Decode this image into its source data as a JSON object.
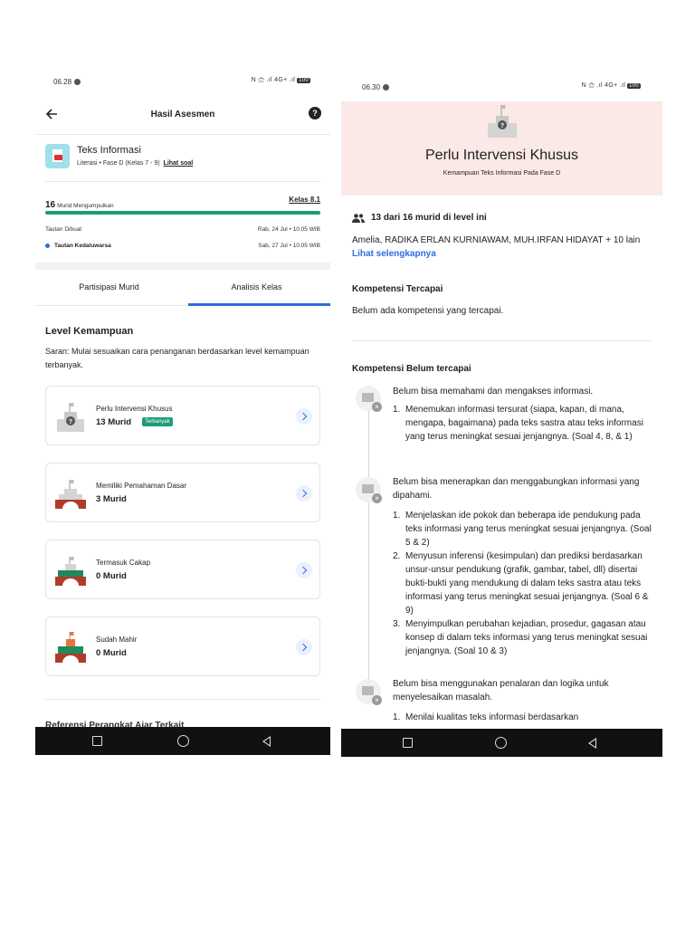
{
  "left": {
    "status": {
      "time": "06.28",
      "icons": "N ⚝ .ıl 4G+ .ıl",
      "battery": "100"
    },
    "appbar": {
      "title": "Hasil Asesmen",
      "back_icon": "back-arrow-icon",
      "help_icon": "help-icon"
    },
    "subject": {
      "title": "Teks Informasi",
      "meta": "Literasi • Fase D (Kelas 7 - 9)",
      "link": "Lihat soal"
    },
    "summary": {
      "count": "16",
      "count_label": "Murid Mengumpulkan",
      "kelas": "Kelas 8.1",
      "progress_fraction": 1.0,
      "created_label": "Tautan Dibuat",
      "created_value": "Rab, 24 Jul • 10:05 WIB",
      "expiry_label": "Tautan Kedaluwarsa",
      "expiry_value": "Sab, 27 Jul • 10:05 WIB"
    },
    "tabs": [
      {
        "label": "Partisipasi Murid",
        "active": false
      },
      {
        "label": "Analisis Kelas",
        "active": true
      }
    ],
    "level_section": {
      "title": "Level Kemampuan",
      "desc": "Saran: Mulai sesuaikan cara penanganan berdasarkan level kemampuan terbanyak."
    },
    "levels": [
      {
        "name": "Perlu Intervensi Khusus",
        "count": "13 Murid",
        "badge": "Terbanyak"
      },
      {
        "name": "Memiliki Pemahaman Dasar",
        "count": "3 Murid",
        "badge": ""
      },
      {
        "name": "Termasuk Cakap",
        "count": "0 Murid",
        "badge": ""
      },
      {
        "name": "Sudah Mahir",
        "count": "0 Murid",
        "badge": ""
      }
    ],
    "cut_heading": "Referensi Perangkat Ajar Terkait"
  },
  "right": {
    "status": {
      "time": "06.30",
      "icons": "N ⚝ .ıl 4G+ .ıl",
      "battery": "100"
    },
    "hero": {
      "title": "Perlu Intervensi Khusus",
      "subtitle": "Kemampuan Teks Informasi Pada Fase D"
    },
    "students": {
      "count": "13 dari 16 murid di level ini",
      "names": "Amelia, RADIKA ERLAN KURNIAWAM, MUH.IRFAN HIDAYAT + 10 lain",
      "more": "Lihat selengkapnya"
    },
    "achieved": {
      "title": "Kompetensi Tercapai",
      "text": "Belum ada kompetensi yang tercapai."
    },
    "not_achieved": {
      "title": "Kompetensi Belum tercapai",
      "items": [
        {
          "title": "Belum bisa memahami dan mengakses informasi.",
          "points": [
            "Menemukan informasi tersurat (siapa, kapan, di mana, mengapa, bagaimana) pada teks sastra atau teks informasi yang terus meningkat sesuai jenjangnya. (Soal 4, 8, & 1)"
          ]
        },
        {
          "title": "Belum bisa menerapkan dan menggabungkan informasi yang dipahami.",
          "points": [
            "Menjelaskan ide pokok dan beberapa ide pendukung pada teks informasi yang terus meningkat sesuai jenjangnya. (Soal 5 & 2)",
            "Menyusun inferensi (kesimpulan) dan prediksi berdasarkan unsur-unsur pendukung (grafik, gambar, tabel, dll) disertai bukti-bukti yang mendukung di dalam teks sastra atau teks informasi yang terus meningkat sesuai jenjangnya. (Soal 6 & 9)",
            "Menyimpulkan perubahan kejadian, prosedur, gagasan atau konsep di dalam teks informasi yang terus meningkat sesuai jenjangnya. (Soal 10 & 3)"
          ]
        },
        {
          "title": "Belum bisa menggunakan penalaran dan logika untuk menyelesaikan masalah.",
          "points": [
            "Menilai kualitas teks informasi berdasarkan"
          ]
        }
      ]
    }
  },
  "colors": {
    "accent": "#2d6cdf",
    "success": "#1a9d77",
    "hero_bg": "#fbe9e7"
  }
}
